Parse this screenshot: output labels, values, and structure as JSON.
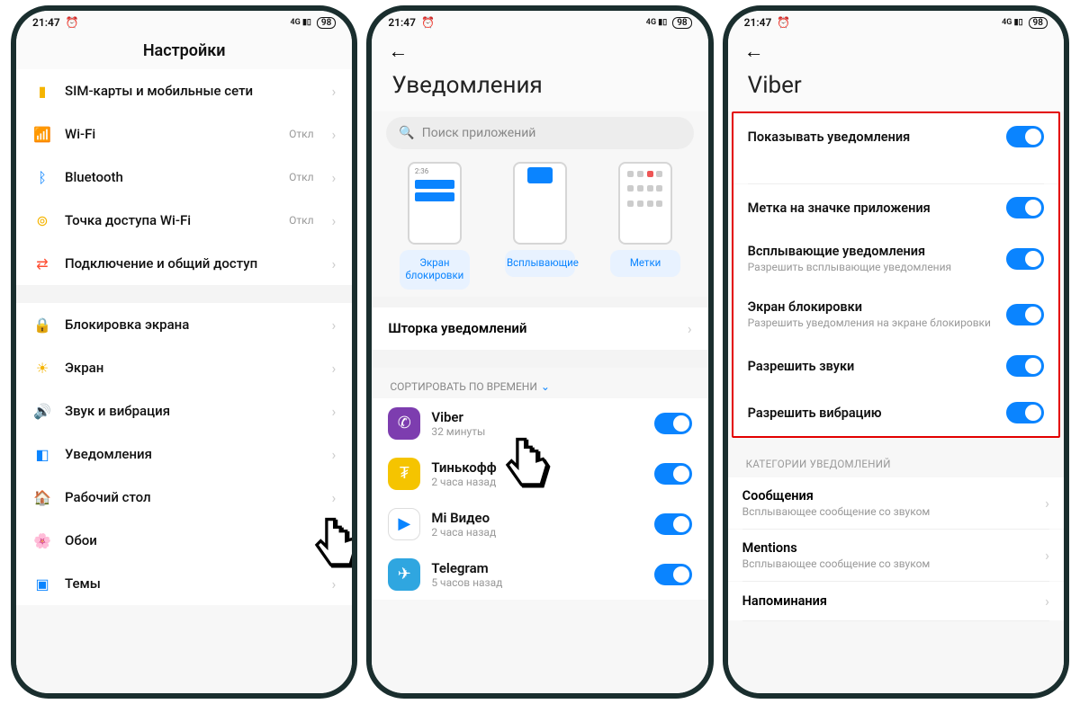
{
  "status": {
    "time": "21:47",
    "battery": "98"
  },
  "phone1": {
    "title": "Настройки",
    "groups": [
      [
        {
          "icon": "sim",
          "color": "#f5b400",
          "label": "SIM-карты и мобильные сети",
          "status": ""
        },
        {
          "icon": "wifi",
          "color": "#0a84ff",
          "label": "Wi-Fi",
          "status": "Откл"
        },
        {
          "icon": "bt",
          "color": "#0a84ff",
          "label": "Bluetooth",
          "status": "Откл"
        },
        {
          "icon": "hotspot",
          "color": "#f5b400",
          "label": "Точка доступа Wi-Fi",
          "status": "Откл"
        },
        {
          "icon": "share",
          "color": "#ff4d32",
          "label": "Подключение и общий доступ",
          "status": ""
        }
      ],
      [
        {
          "icon": "lock",
          "color": "#ff4d32",
          "label": "Блокировка экрана",
          "status": ""
        },
        {
          "icon": "sun",
          "color": "#f5b400",
          "label": "Экран",
          "status": ""
        },
        {
          "icon": "sound",
          "color": "#2ecc40",
          "label": "Звук и вибрация",
          "status": ""
        },
        {
          "icon": "notif",
          "color": "#0a84ff",
          "label": "Уведомления",
          "status": ""
        },
        {
          "icon": "home",
          "color": "#7b3ff2",
          "label": "Рабочий стол",
          "status": ""
        },
        {
          "icon": "wall",
          "color": "#ff4da6",
          "label": "Обои",
          "status": ""
        },
        {
          "icon": "theme",
          "color": "#0a84ff",
          "label": "Темы",
          "status": ""
        }
      ]
    ]
  },
  "phone2": {
    "title": "Уведомления",
    "search_placeholder": "Поиск приложений",
    "preview_labels": [
      "Экран блокировки",
      "Всплывающие",
      "Метки"
    ],
    "shade_label": "Шторка уведомлений",
    "sort_label": "СОРТИРОВАТЬ ПО ВРЕМЕНИ",
    "apps": [
      {
        "name": "Viber",
        "sub": "32 минуты",
        "bg": "#7d3daf"
      },
      {
        "name": "Тинькофф",
        "sub": "2 часа назад",
        "bg": "#f5c400"
      },
      {
        "name": "Mi Видео",
        "sub": "2 часа назад",
        "bg": "#ffffff"
      },
      {
        "name": "Telegram",
        "sub": "5 часов назад",
        "bg": "#2fa6e0"
      }
    ]
  },
  "phone3": {
    "title": "Viber",
    "toggles": [
      {
        "title": "Показывать уведомления",
        "sub": ""
      },
      {
        "title": "Метка на значке приложения",
        "sub": ""
      },
      {
        "title": "Всплывающие уведомления",
        "sub": "Разрешить всплывающие уведомления"
      },
      {
        "title": "Экран блокировки",
        "sub": "Разрешить уведомления на экране блокировки"
      },
      {
        "title": "Разрешить звуки",
        "sub": ""
      },
      {
        "title": "Разрешить вибрацию",
        "sub": ""
      }
    ],
    "cat_header": "КАТЕГОРИИ УВЕДОМЛЕНИЙ",
    "categories": [
      {
        "title": "Сообщения",
        "sub": "Всплывающее сообщение со звуком"
      },
      {
        "title": "Mentions",
        "sub": "Всплывающее сообщение со звуком"
      },
      {
        "title": "Напоминания",
        "sub": ""
      }
    ]
  }
}
